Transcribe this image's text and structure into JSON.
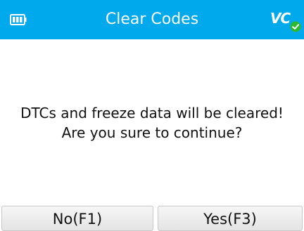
{
  "header": {
    "title": "Clear Codes",
    "battery_icon": "battery-icon",
    "vci_label": "VC",
    "vci_status_icon": "connected-check-icon"
  },
  "dialog": {
    "line1": "DTCs and freeze data will be cleared!",
    "line2": "Are you sure to continue?"
  },
  "buttons": {
    "no_label": "No(F1)",
    "yes_label": "Yes(F3)"
  },
  "colors": {
    "titlebar": "#00a8ec",
    "check_badge": "#2eb82e"
  }
}
